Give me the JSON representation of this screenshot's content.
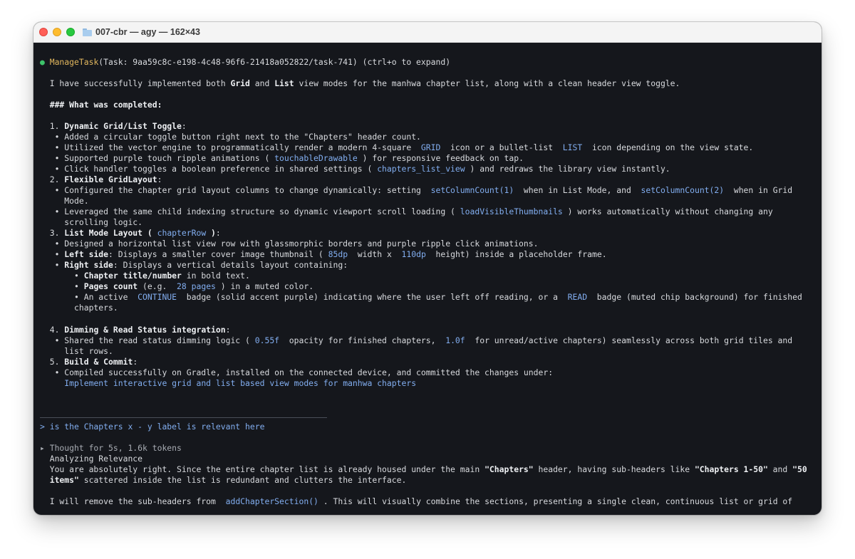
{
  "window": {
    "title": "007-cbr — agy — 162×43"
  },
  "task": {
    "bullet": "●",
    "tool": "ManageTask",
    "args": "(Task: 9aa59c8c-e198-4c48-96f6-21418a052822/task-741) (ctrl+o to expand)"
  },
  "summary": {
    "intro_1": "I have successfully implemented both ",
    "grid": "Grid",
    "and": " and ",
    "list": "List",
    "intro_2": " view modes for the manhwa chapter list, along with a clean header view toggle.",
    "heading": "### What was completed:"
  },
  "items": {
    "i1": {
      "num": "1. ",
      "title": "Dynamic Grid/List Toggle",
      "colon": ":",
      "b1": "   • Added a circular toggle button right next to the \"Chapters\" header count.",
      "b2a": "   • Utilized the vector engine to programmatically render a modern 4-square ",
      "b2_grid": " GRID ",
      "b2b": " icon or a bullet-list ",
      "b2_list": " LIST ",
      "b2c": " icon depending on the view state.",
      "b3a": "   • Supported purple touch ripple animations ( ",
      "b3_code": "touchableDrawable",
      "b3b": " ) for responsive feedback on tap.",
      "b4a": "   • Click handler toggles a boolean preference in shared settings ( ",
      "b4_code": "chapters_list_view",
      "b4b": " ) and redraws the library view instantly."
    },
    "i2": {
      "num": "2. ",
      "title": "Flexible GridLayout",
      "colon": ":",
      "b1a": "   • Configured the chapter grid layout columns to change dynamically: setting ",
      "b1_code1": " setColumnCount(1) ",
      "b1b": " when in List Mode, and ",
      "b1_code2": " setColumnCount(2) ",
      "b1c": " when in Grid",
      "b1d": "     Mode.",
      "b2a": "   • Leveraged the same child indexing structure so dynamic viewport scroll loading ( ",
      "b2_code": "loadVisibleThumbnails",
      "b2b": " ) works automatically without changing any",
      "b2c": "     scrolling logic."
    },
    "i3": {
      "num": "3. ",
      "title": "List Mode Layout",
      "title_b": " ( ",
      "code": "chapterRow",
      "title_c": " )",
      "colon": ":",
      "b1": "   • Designed a horizontal list view row with glassmorphic borders and purple ripple click animations.",
      "b2_pre": "   • ",
      "b2_bold": "Left side",
      "b2a": ": Displays a smaller cover image thumbnail ( ",
      "b2_code1": "85dp",
      "b2b": "  width x  ",
      "b2_code2": "110dp",
      "b2c": "  height) inside a placeholder frame.",
      "b3_pre": "   • ",
      "b3_bold": "Right side",
      "b3a": ": Displays a vertical details layout containing:",
      "s1_pre": "       • ",
      "s1_bold": "Chapter title/number",
      "s1a": " in bold text.",
      "s2_pre": "       • ",
      "s2_bold": "Pages count",
      "s2a": " (e.g.  ",
      "s2_code": "28 pages",
      "s2b": " ) in a muted color.",
      "s3a": "       • An active  ",
      "s3_code1": "CONTINUE",
      "s3b": "  badge (solid accent purple) indicating where the user left off reading, or a  ",
      "s3_code2": "READ",
      "s3c": "  badge (muted chip background) for finished",
      "s3d": "       chapters."
    },
    "i4": {
      "num": "4. ",
      "title": "Dimming & Read Status integration",
      "colon": ":",
      "b1a": "   • Shared the read status dimming logic ( ",
      "b1_code1": "0.55f",
      "b1b": "  opacity for finished chapters,  ",
      "b1_code2": "1.0f",
      "b1c": "  for unread/active chapters) seamlessly across both grid tiles and",
      "b1d": "     list rows."
    },
    "i5": {
      "num": "5. ",
      "title": "Build & Commit",
      "colon": ":",
      "b1": "   • Compiled successfully on Gradle, installed on the connected device, and committed the changes under:",
      "commit_pad": "     ",
      "commit": "Implement interactive grid and list based view modes for manhwa chapters"
    }
  },
  "prompt": {
    "text": "> is the Chapters x - y label is relevant here"
  },
  "response": {
    "thought": "▸ Thought for 5s, 1.6k tokens",
    "analyzing": "  Analyzing Relevance",
    "p1a": "  You are absolutely right. Since the entire chapter list is already housed under the main ",
    "p1_b1": "\"Chapters\"",
    "p1b": " header, having sub-headers like ",
    "p1_b2": "\"Chapters 1-50\"",
    "p1c": " and ",
    "p1_b3": "\"50",
    "p2_pre": "  ",
    "p2_b": "items\"",
    "p2a": " scattered inside the list is redundant and clutters the interface.",
    "p3a": "  I will remove the sub-headers from  ",
    "p3_code": "addChapterSection()",
    "p3b": " . This will visually combine the sections, presenting a single clean, continuous list or grid of"
  }
}
